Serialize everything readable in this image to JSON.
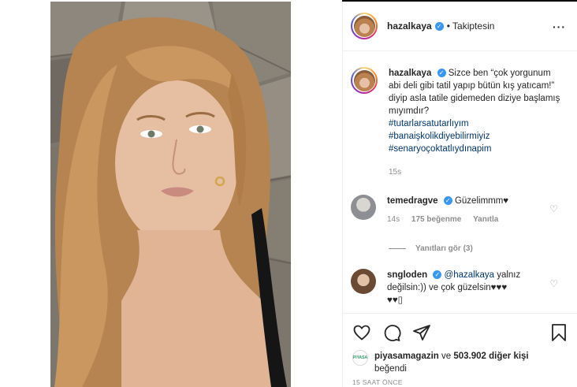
{
  "post": {
    "username": "hazalkaya",
    "follow_status": "Takiptesin",
    "more_icon": "more-horizontal-icon"
  },
  "caption": {
    "username": "hazalkaya",
    "text": "Sizce ben “çok yorgunum abi deli gibi tatil yapıp bütün kış yatıcam!” diyip asla tatile gidemeden diziye başlamış mıyımdır?",
    "hashtags": [
      "#tutarlarsatutarlıyım",
      "#banaişkolikdiyebilirmiyiz",
      "#senaryoçoktatlıydınapim"
    ],
    "time": "15s"
  },
  "comments": [
    {
      "username": "temedragve",
      "text": "Güzelimmm♥",
      "time": "14s",
      "likes": "175 beğenme",
      "reply": "Yanıtla",
      "view_replies": "Yanıtları gör (3)"
    },
    {
      "username": "sngloden",
      "mention": "@hazalkaya",
      "text": " yalnız değilsin:)) ve çok güzelsin♥♥♥",
      "text_line2": "♥♥▯"
    }
  ],
  "likes": {
    "avatar_label": "PIYASA",
    "user": "piyasamagazin",
    "connector": " ve ",
    "count": "503.902 diğer kişi",
    "suffix": "beğendi"
  },
  "timestamp": "15 SAAT ÖNCE",
  "colors": {
    "link": "#00376b",
    "verified": "#3897f0",
    "muted": "#8e8e8e"
  }
}
